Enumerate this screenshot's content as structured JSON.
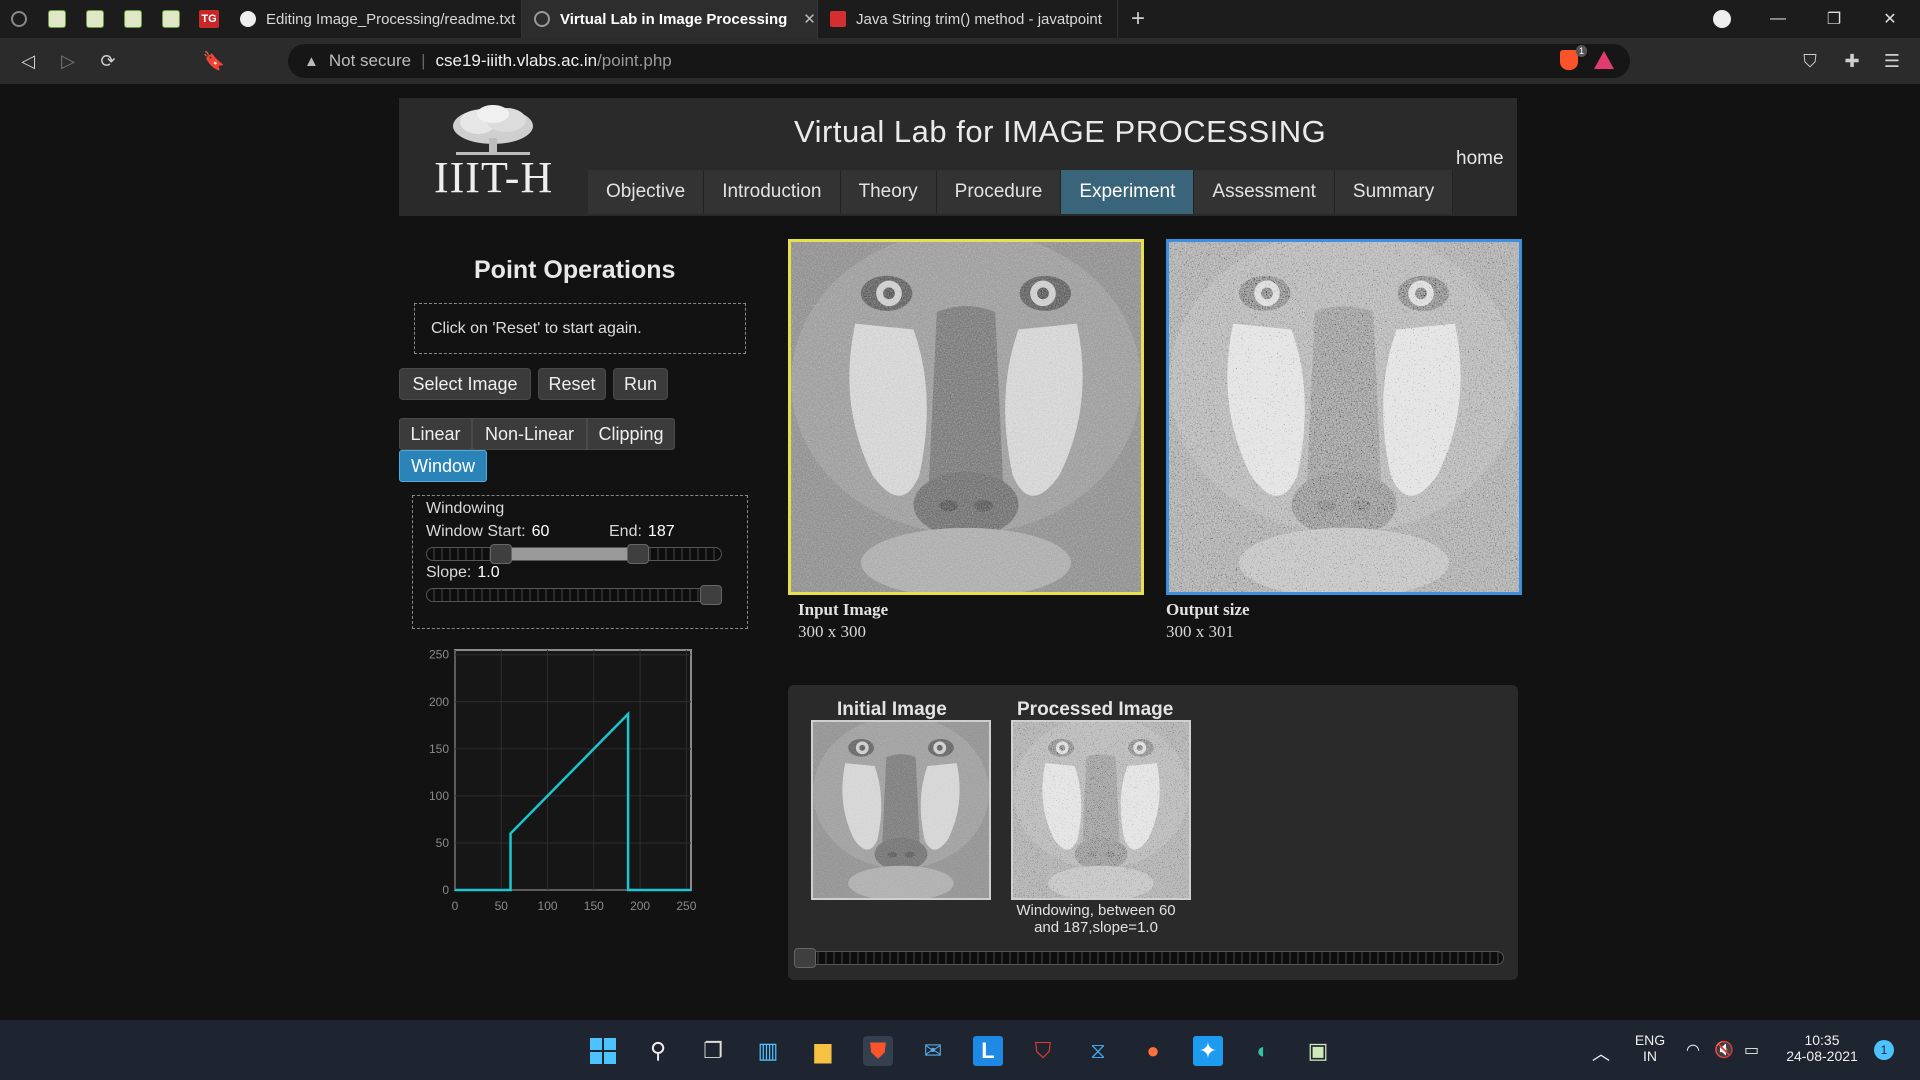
{
  "browser": {
    "tabs": [
      {
        "title": "Editing Image_Processing/readme.txt ·",
        "active": false
      },
      {
        "title": "Virtual Lab in Image Processing",
        "active": true
      },
      {
        "title": "Java String trim() method - javatpoint",
        "active": false
      }
    ],
    "pinned_tabs": [
      "globe-icon",
      "image-icon",
      "image-icon",
      "image-icon",
      "image-icon",
      "tg-icon"
    ],
    "tg_label": "TG",
    "brave_badge": "1",
    "address": {
      "security": "Not secure",
      "host": "cse19-iiith.vlabs.ac.in",
      "path": "/point.php"
    }
  },
  "header": {
    "logo_text": "IIIT-H",
    "title": "Virtual Lab for IMAGE PROCESSING",
    "home": "home",
    "nav": [
      {
        "label": "Objective",
        "active": false
      },
      {
        "label": "Introduction",
        "active": false
      },
      {
        "label": "Theory",
        "active": false
      },
      {
        "label": "Procedure",
        "active": false
      },
      {
        "label": "Experiment",
        "active": true
      },
      {
        "label": "Assessment",
        "active": false
      },
      {
        "label": "Summary",
        "active": false
      }
    ]
  },
  "panel": {
    "title": "Point Operations",
    "info": "Click on 'Reset' to start again.",
    "buttons": {
      "select": "Select Image",
      "reset": "Reset",
      "run": "Run"
    },
    "ops": {
      "linear": "Linear",
      "nonlinear": "Non-Linear",
      "clipping": "Clipping",
      "window": "Window"
    },
    "active_op": "Window",
    "windowing": {
      "heading": "Windowing",
      "start_label": "Window Start:",
      "start_value": "60",
      "end_label": "End:",
      "end_value": "187",
      "slope_label": "Slope:",
      "slope_value": "1.0",
      "range_min": 0,
      "range_max": 255,
      "slope_fraction": 1.0
    }
  },
  "chart_data": {
    "type": "line",
    "title": "",
    "xlabel": "",
    "ylabel": "",
    "x": [
      0,
      60,
      60,
      187,
      187,
      255
    ],
    "y": [
      0,
      0,
      60,
      187,
      0,
      0
    ],
    "xlim": [
      0,
      255
    ],
    "ylim": [
      0,
      255
    ],
    "xticks": [
      0,
      50,
      100,
      150,
      200,
      250
    ],
    "yticks": [
      0,
      50,
      100,
      150,
      200,
      250
    ],
    "color": "#19c6d1",
    "grid": true
  },
  "images": {
    "input_label": "Input Image",
    "input_size": "300 x 300",
    "output_label": "Output size",
    "output_size": "300 x 301"
  },
  "history": {
    "initial_title": "Initial Image",
    "processed_title": "Processed Image",
    "caption": "Windowing, between 60 and 187,slope=1.0",
    "scroll_position": 0
  },
  "taskbar": {
    "lang": "ENG",
    "region": "IN",
    "time": "10:35",
    "date": "24-08-2021",
    "notification_count": "1"
  },
  "colors": {
    "accent": "#2a84b8",
    "nav_active": "#3a6479",
    "input_border": "#e7e04a",
    "output_border": "#3d8fe0",
    "curve": "#19c6d1"
  }
}
